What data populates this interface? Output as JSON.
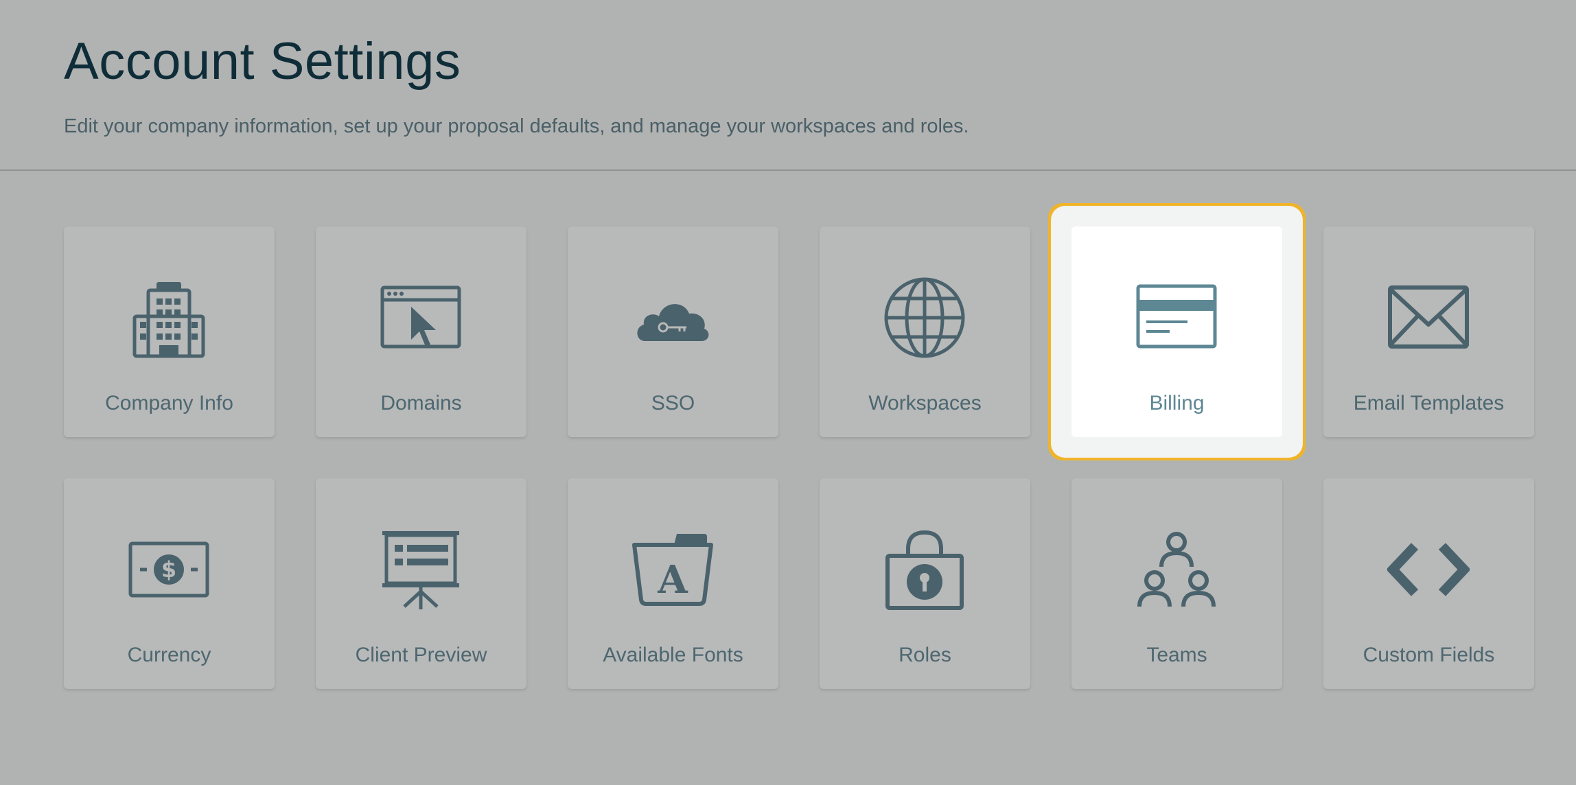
{
  "page": {
    "title": "Account Settings",
    "subtitle": "Edit your company information, set up your proposal defaults, and manage your workspaces and roles."
  },
  "colors": {
    "icon": "#4a626c",
    "icon_selected": "#5e8794",
    "highlight_border": "#f0b429"
  },
  "tiles": [
    {
      "label": "Company Info",
      "icon": "building-icon"
    },
    {
      "label": "Domains",
      "icon": "browser-cursor-icon"
    },
    {
      "label": "SSO",
      "icon": "cloud-key-icon"
    },
    {
      "label": "Workspaces",
      "icon": "globe-icon"
    },
    {
      "label": "Billing",
      "icon": "credit-card-icon",
      "selected": true
    },
    {
      "label": "Email Templates",
      "icon": "envelope-icon"
    },
    {
      "label": "Currency",
      "icon": "dollar-bill-icon"
    },
    {
      "label": "Client Preview",
      "icon": "presentation-board-icon"
    },
    {
      "label": "Available Fonts",
      "icon": "font-folder-icon"
    },
    {
      "label": "Roles",
      "icon": "padlock-icon"
    },
    {
      "label": "Teams",
      "icon": "team-people-icon"
    },
    {
      "label": "Custom Fields",
      "icon": "code-brackets-icon"
    }
  ]
}
